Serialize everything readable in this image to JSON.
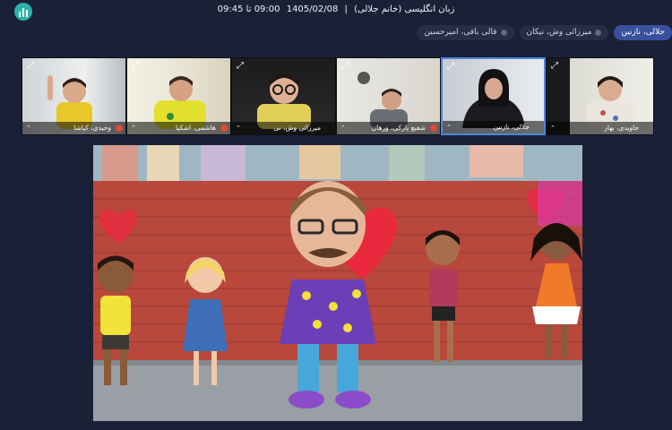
{
  "header": {
    "title_class": "زبان انگلیسی (خانم جلالی)",
    "title_date": "1405/02/08",
    "title_time": "09:00 تا 09:45",
    "separator": "|"
  },
  "chips": [
    {
      "label": "جلالی، نازنین",
      "active": true
    },
    {
      "label": "میرزائی وش، نیکان",
      "active": false
    },
    {
      "label": "فالی بافی، امیرحسین",
      "active": false
    }
  ],
  "participants": [
    {
      "name": "وحیدی، کیاشا",
      "mic_muted": true
    },
    {
      "name": "هاشمی، اشکیا",
      "mic_muted": true
    },
    {
      "name": "میرزائی وش، نی",
      "mic_muted": false
    },
    {
      "name": "شفیع پارکی، ورهان",
      "mic_muted": true
    },
    {
      "name": "جلالی، نازنین",
      "mic_muted": false
    },
    {
      "name": "جاویدی، بهار",
      "mic_muted": false
    }
  ],
  "colors": {
    "background": "#1a2036",
    "accent": "#3a4f9e",
    "logo": "#2bb3a7",
    "speaker_border": "#4a86e0"
  }
}
